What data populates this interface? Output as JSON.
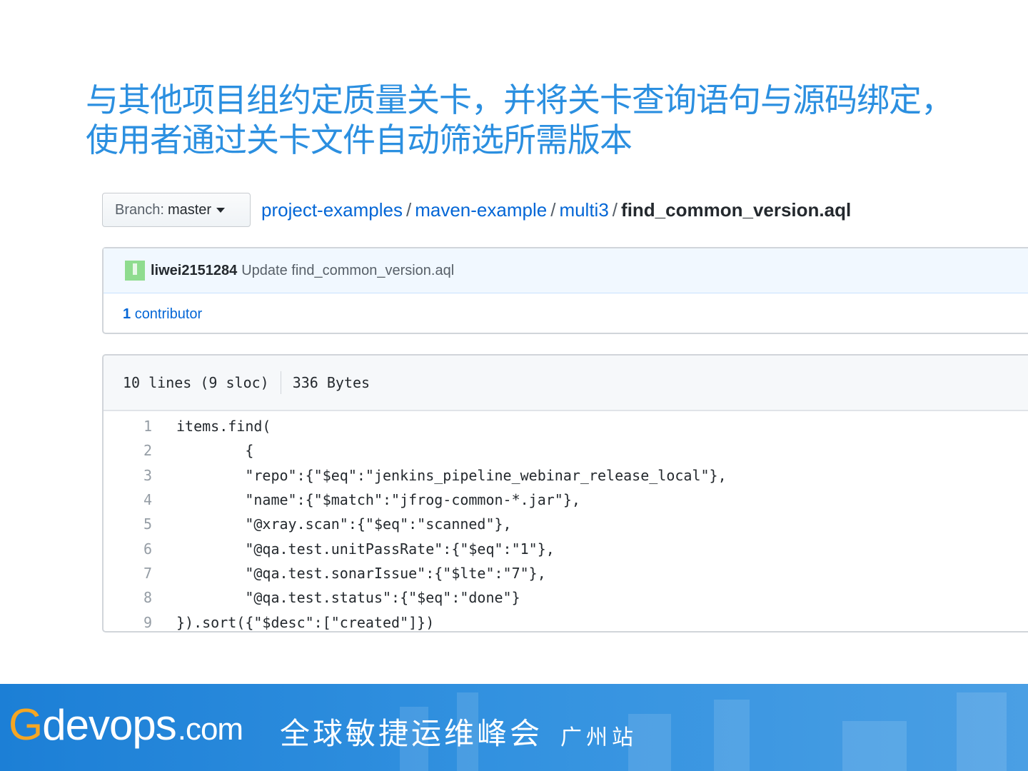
{
  "slide": {
    "title": "与其他项目组约定质量关卡，并将关卡查询语句与源码绑定，使用者通过关卡文件自动筛选所需版本"
  },
  "branch": {
    "label": "Branch:",
    "value": "master"
  },
  "breadcrumb": [
    "project-examples",
    "maven-example",
    "multi3",
    "find_common_version.aql"
  ],
  "commit": {
    "user": "liwei2151284",
    "message": "Update find_common_version.aql",
    "contributors_count": "1",
    "contributors_label": "contributor"
  },
  "file": {
    "lines": "10 lines (9 sloc)",
    "size": "336 Bytes"
  },
  "code": [
    {
      "n": "1",
      "text": "items.find("
    },
    {
      "n": "2",
      "text": "        {"
    },
    {
      "n": "3",
      "text": "        \"repo\":{\"$eq\":\"jenkins_pipeline_webinar_release_local\"},"
    },
    {
      "n": "4",
      "text": "        \"name\":{\"$match\":\"jfrog-common-*.jar\"},"
    },
    {
      "n": "5",
      "text": "        \"@xray.scan\":{\"$eq\":\"scanned\"},"
    },
    {
      "n": "6",
      "text": "        \"@qa.test.unitPassRate\":{\"$eq\":\"1\"},"
    },
    {
      "n": "7",
      "text": "        \"@qa.test.sonarIssue\":{\"$lte\":\"7\"},"
    },
    {
      "n": "8",
      "text": "        \"@qa.test.status\":{\"$eq\":\"done\"}"
    },
    {
      "n": "9",
      "text": "}).sort({\"$desc\":[\"created\"]})"
    }
  ],
  "footer": {
    "logo_g": "G",
    "logo_main": "devops",
    "logo_com": ".com",
    "slogan": "全球敏捷运维峰会",
    "city": "广州站"
  }
}
